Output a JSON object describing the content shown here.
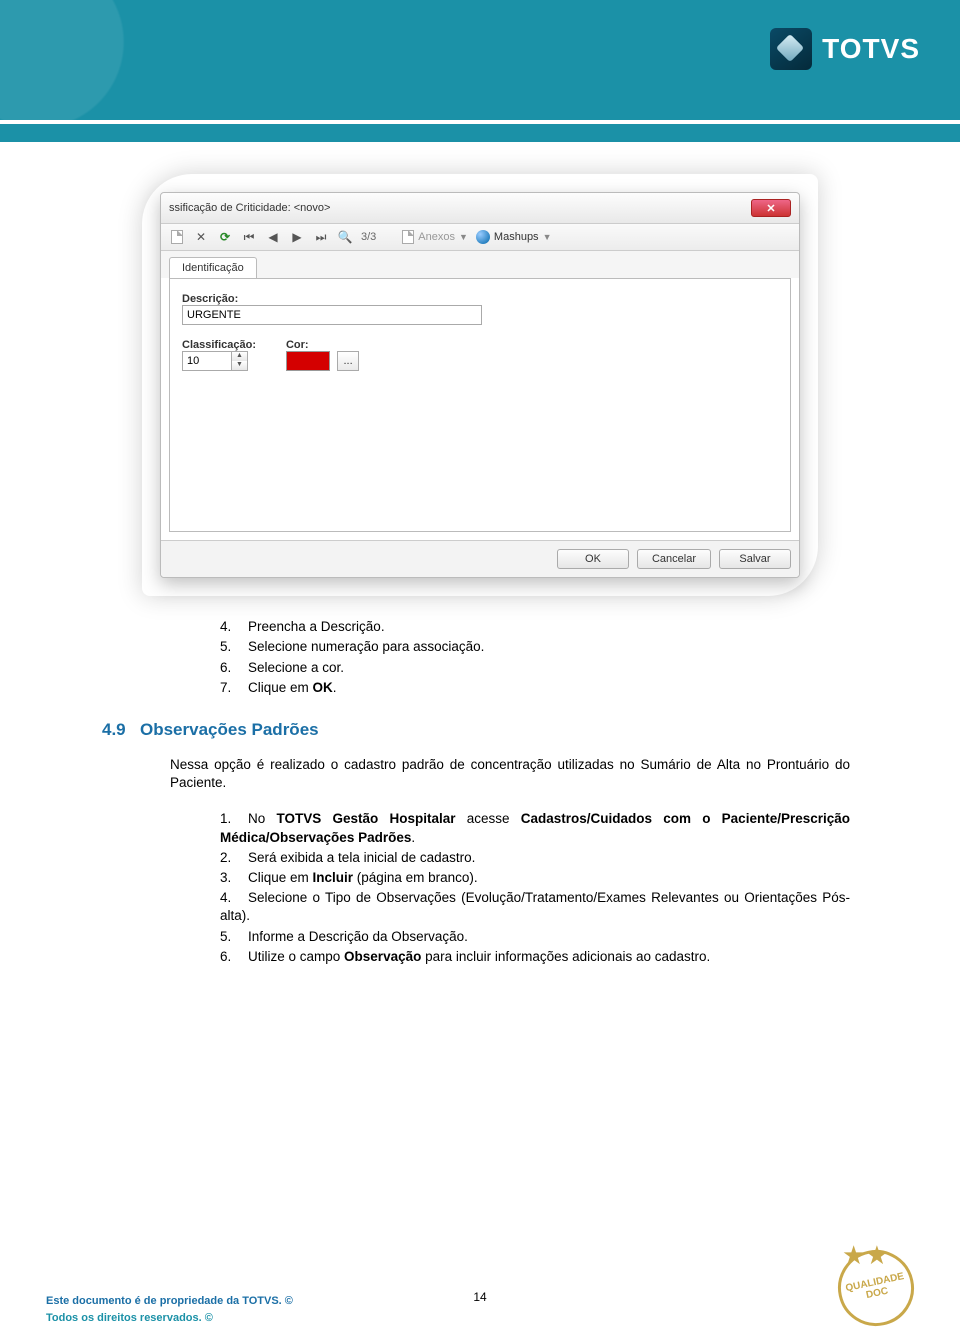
{
  "brand": {
    "name": "TOTVS"
  },
  "window": {
    "title": "ssificação de Criticidade: <novo>",
    "toolbar": {
      "pager": "3/3",
      "anexos_label": "Anexos",
      "mashups_label": "Mashups"
    },
    "tab": "Identificação",
    "labels": {
      "descricao": "Descrição:",
      "classificacao": "Classificação:",
      "cor": "Cor:"
    },
    "values": {
      "descricao": "URGENTE",
      "classificacao": "10",
      "cor": "#d40000"
    },
    "color_picker_btn": "...",
    "buttons": {
      "ok": "OK",
      "cancelar": "Cancelar",
      "salvar": "Salvar"
    }
  },
  "steps_a": [
    {
      "n": "4",
      "text": "Preencha a Descrição."
    },
    {
      "n": "5",
      "text": "Selecione numeração para associação."
    },
    {
      "n": "6",
      "text": "Selecione a cor."
    },
    {
      "n": "7",
      "text_pre": "Clique em ",
      "bold": "OK",
      "text_post": "."
    }
  ],
  "section": {
    "num": "4.9",
    "title": "Observações Padrões",
    "paragraph": "Nessa opção é realizado o cadastro padrão de concentração utilizadas no Sumário de Alta no Prontuário do Paciente."
  },
  "steps_b": [
    {
      "n": "1",
      "segments": [
        "No ",
        {
          "b": "TOTVS Gestão Hospitalar"
        },
        " acesse ",
        {
          "b": "Cadastros/Cuidados com o Paciente/Prescrição Médica/Observações Padrões"
        },
        "."
      ]
    },
    {
      "n": "2",
      "segments": [
        "Será exibida a tela inicial de cadastro."
      ]
    },
    {
      "n": "3",
      "segments": [
        "Clique em ",
        {
          "b": "Incluir"
        },
        " (página em branco)."
      ]
    },
    {
      "n": "4",
      "segments": [
        "Selecione o Tipo de Observações (Evolução/Tratamento/Exames Relevantes ou Orientações Pós-alta)."
      ]
    },
    {
      "n": "5",
      "segments": [
        "Informe a Descrição da Observação."
      ]
    },
    {
      "n": "6",
      "segments": [
        "Utilize o campo ",
        {
          "b": "Observação"
        },
        " para incluir informações adicionais ao cadastro."
      ]
    }
  ],
  "footer": {
    "line1": "Este documento é de propriedade da TOTVS. ©",
    "line2": "Todos os direitos reservados. ©",
    "page": "14",
    "badge": "QUALIDADE DOC"
  }
}
